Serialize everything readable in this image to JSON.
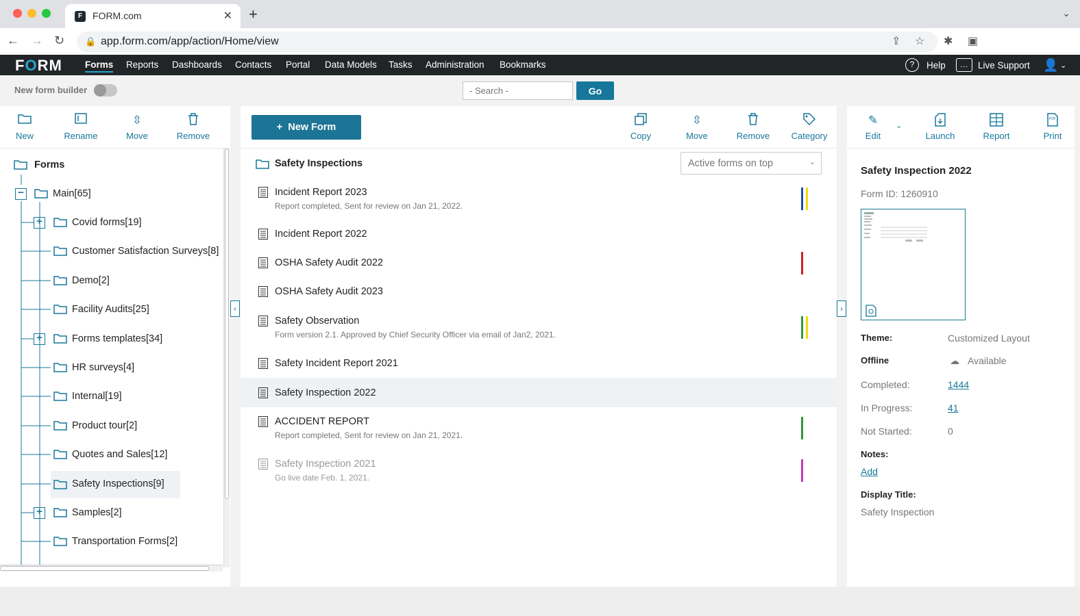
{
  "browser": {
    "tab_title": "FORM.com",
    "url": "app.form.com/app/action/Home/view"
  },
  "app": {
    "logo": "FORM",
    "nav": [
      "Forms",
      "Reports",
      "Dashboards",
      "Contacts",
      "Portal",
      "Data Models",
      "Tasks",
      "Administration",
      "Bookmarks"
    ],
    "help": "Help",
    "live_support": "Live Support"
  },
  "subbar": {
    "new_form_builder": "New form builder",
    "search_placeholder": "- Search -",
    "go": "Go"
  },
  "left": {
    "toolbar": [
      "New",
      "Rename",
      "Move",
      "Remove"
    ],
    "root": "Forms",
    "main": "Main[65]",
    "folders": [
      "Covid forms[19]",
      "Customer Satisfaction Surveys[8]",
      "Demo[2]",
      "Facility Audits[25]",
      "Forms templates[34]",
      "HR surveys[4]",
      "Internal[19]",
      "Product tour[2]",
      "Quotes and Sales[12]",
      "Safety Inspections[9]",
      "Samples[2]",
      "Transportation Forms[2]"
    ]
  },
  "mid": {
    "new_form": "New Form",
    "toolbar": [
      "Copy",
      "Move",
      "Remove",
      "Category"
    ],
    "folder": "Safety Inspections",
    "sort": "Active forms on top",
    "forms": [
      {
        "name": "Incident Report 2023",
        "desc": "Report completed, Sent for review on Jan 21, 2022."
      },
      {
        "name": "Incident Report 2022",
        "desc": ""
      },
      {
        "name": "OSHA Safety Audit 2022",
        "desc": ""
      },
      {
        "name": "OSHA Safety Audit 2023",
        "desc": ""
      },
      {
        "name": "Safety Observation",
        "desc": "Form version 2.1. Approved by Chief Security Officer via email of Jan2, 2021."
      },
      {
        "name": "Safety Incident Report 2021",
        "desc": ""
      },
      {
        "name": "Safety Inspection 2022",
        "desc": ""
      },
      {
        "name": "ACCIDENT REPORT",
        "desc": "Report completed, Sent for review on Jan 21, 2021."
      },
      {
        "name": "Safety Inspection 2021",
        "desc": "Go live date Feb. 1, 2021."
      }
    ],
    "colors": {
      "blue": "#1f4fa8",
      "yellow": "#f5d90a",
      "red": "#cc1f1f",
      "green": "#2e9a3a",
      "magenta": "#c23bb5"
    }
  },
  "right": {
    "toolbar": [
      "Edit",
      "Launch",
      "Report",
      "Print"
    ],
    "title": "Safety Inspection 2022",
    "form_id": "Form ID: 1260910",
    "details": {
      "theme_label": "Theme:",
      "theme": "Customized Layout",
      "offline_label": "Offline",
      "offline": "Available",
      "completed_label": "Completed:",
      "completed": "1444",
      "inprogress_label": "In Progress:",
      "inprogress": "41",
      "notstarted_label": "Not Started:",
      "notstarted": "0",
      "notes_label": "Notes:",
      "notes_add": "Add",
      "display_title_label": "Display Title:",
      "display_title": "Safety Inspection"
    }
  }
}
